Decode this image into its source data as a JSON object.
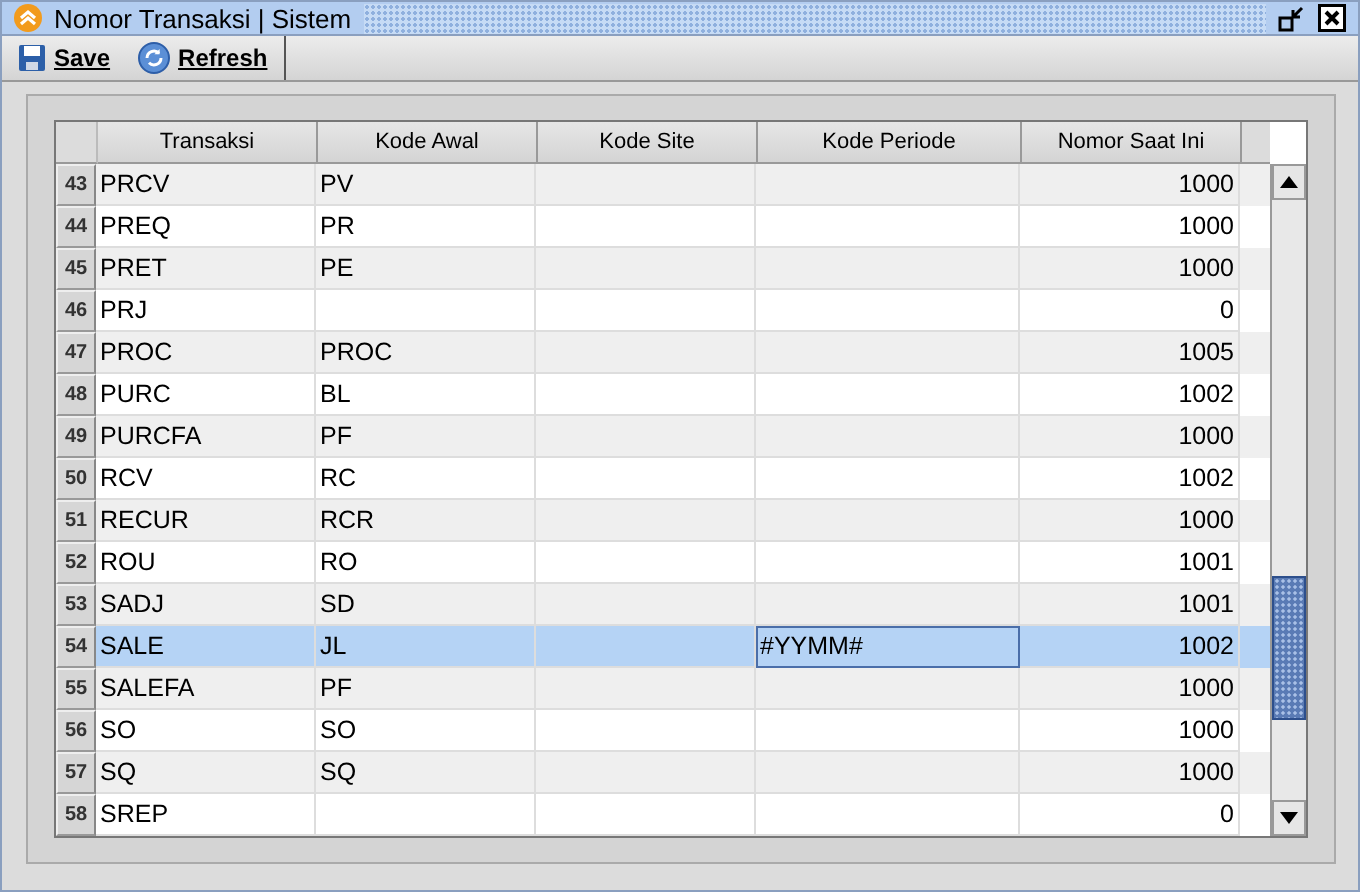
{
  "window": {
    "title": "Nomor Transaksi | Sistem"
  },
  "toolbar": [
    {
      "kind": "save",
      "label": "Save"
    },
    {
      "kind": "refresh",
      "label": "Refresh"
    }
  ],
  "table": {
    "columns": [
      "Transaksi",
      "Kode Awal",
      "Kode Site",
      "Kode Periode",
      "Nomor Saat Ini"
    ],
    "rows": [
      {
        "num": "43",
        "cells": [
          "PRCV",
          "PV",
          "",
          "",
          "1000"
        ],
        "selected": false,
        "focused": false
      },
      {
        "num": "44",
        "cells": [
          "PREQ",
          "PR",
          "",
          "",
          "1000"
        ],
        "selected": false,
        "focused": false
      },
      {
        "num": "45",
        "cells": [
          "PRET",
          "PE",
          "",
          "",
          "1000"
        ],
        "selected": false,
        "focused": false
      },
      {
        "num": "46",
        "cells": [
          "PRJ",
          "",
          "",
          "",
          "0"
        ],
        "selected": false,
        "focused": false
      },
      {
        "num": "47",
        "cells": [
          "PROC",
          "PROC",
          "",
          "",
          "1005"
        ],
        "selected": false,
        "focused": false
      },
      {
        "num": "48",
        "cells": [
          "PURC",
          "BL",
          "",
          "",
          "1002"
        ],
        "selected": false,
        "focused": false
      },
      {
        "num": "49",
        "cells": [
          "PURCFA",
          "PF",
          "",
          "",
          "1000"
        ],
        "selected": false,
        "focused": false
      },
      {
        "num": "50",
        "cells": [
          "RCV",
          "RC",
          "",
          "",
          "1002"
        ],
        "selected": false,
        "focused": false
      },
      {
        "num": "51",
        "cells": [
          "RECUR",
          "RCR",
          "",
          "",
          "1000"
        ],
        "selected": false,
        "focused": false
      },
      {
        "num": "52",
        "cells": [
          "ROU",
          "RO",
          "",
          "",
          "1001"
        ],
        "selected": false,
        "focused": false
      },
      {
        "num": "53",
        "cells": [
          "SADJ",
          "SD",
          "",
          "",
          "1001"
        ],
        "selected": false,
        "focused": false
      },
      {
        "num": "54",
        "cells": [
          "SALE",
          "JL",
          "",
          "#YYMM#",
          "1002"
        ],
        "selected": true,
        "focused": true
      },
      {
        "num": "55",
        "cells": [
          "SALEFA",
          "PF",
          "",
          "",
          "1000"
        ],
        "selected": false,
        "focused": false
      },
      {
        "num": "56",
        "cells": [
          "SO",
          "SO",
          "",
          "",
          "1000"
        ],
        "selected": false,
        "focused": false
      },
      {
        "num": "57",
        "cells": [
          "SQ",
          "SQ",
          "",
          "",
          "1000"
        ],
        "selected": false,
        "focused": false
      },
      {
        "num": "58",
        "cells": [
          "SREP",
          "",
          "",
          "",
          "0"
        ],
        "selected": false,
        "focused": false
      }
    ]
  }
}
